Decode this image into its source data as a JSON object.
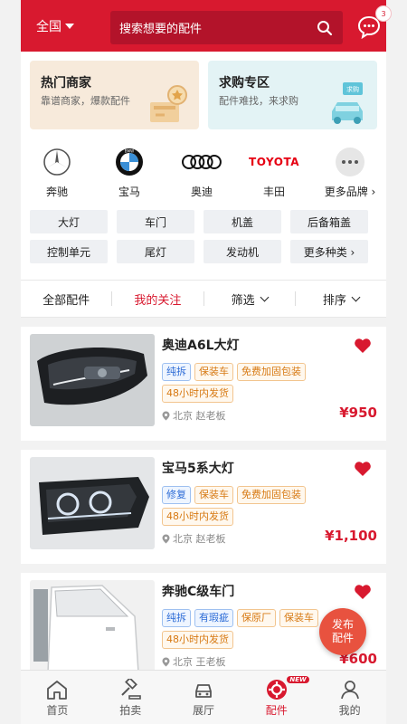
{
  "header": {
    "region": "全国",
    "search_placeholder": "搜索想要的配件",
    "message_badge": "3"
  },
  "promos": [
    {
      "title": "热门商家",
      "subtitle": "靠谱商家，爆款配件"
    },
    {
      "title": "求购专区",
      "subtitle": "配件难找，来求购"
    }
  ],
  "brands": [
    {
      "name": "奔驰",
      "icon": "mercedes-logo"
    },
    {
      "name": "宝马",
      "icon": "bmw-logo"
    },
    {
      "name": "奥迪",
      "icon": "audi-logo"
    },
    {
      "name": "丰田",
      "icon": "toyota-logo",
      "logo_text": "TOYOTA"
    },
    {
      "name": "更多品牌 ›",
      "icon": "more-dots-icon"
    }
  ],
  "categories": [
    "大灯",
    "车门",
    "机盖",
    "后备箱盖",
    "控制单元",
    "尾灯",
    "发动机",
    "更多种类 ›"
  ],
  "filters": {
    "all": "全部配件",
    "follow": "我的关注",
    "filter": "筛选",
    "sort": "排序"
  },
  "products": [
    {
      "title": "奥迪A6L大灯",
      "tags_row1": [
        "纯拆",
        "保装车",
        "免费加固包装"
      ],
      "tags_row2": [
        "48小时内发货"
      ],
      "location": "北京 赵老板",
      "price": "¥950"
    },
    {
      "title": "宝马5系大灯",
      "tags_row1": [
        "修复",
        "保装车",
        "免费加固包装"
      ],
      "tags_row2": [
        "48小时内发货"
      ],
      "location": "北京 赵老板",
      "price": "¥1,100"
    },
    {
      "title": "奔驰C级车门",
      "tags_row1": [
        "纯拆",
        "有瑕疵",
        "保原厂",
        "保装车"
      ],
      "tags_row2": [
        "48小时内发货"
      ],
      "location": "北京 王老板",
      "price": "¥600"
    }
  ],
  "fab": {
    "line1": "发布",
    "line2": "配件"
  },
  "tabbar": [
    {
      "label": "首页",
      "icon": "home-icon"
    },
    {
      "label": "拍卖",
      "icon": "gavel-icon"
    },
    {
      "label": "展厅",
      "icon": "car-icon"
    },
    {
      "label": "配件",
      "icon": "parts-icon",
      "badge": "NEW"
    },
    {
      "label": "我的",
      "icon": "user-icon"
    }
  ],
  "colors": {
    "brand_red": "#d8192f",
    "tag_blue": "#2d6cd6",
    "tag_orange": "#d77a14",
    "price_red": "#d8192f"
  }
}
